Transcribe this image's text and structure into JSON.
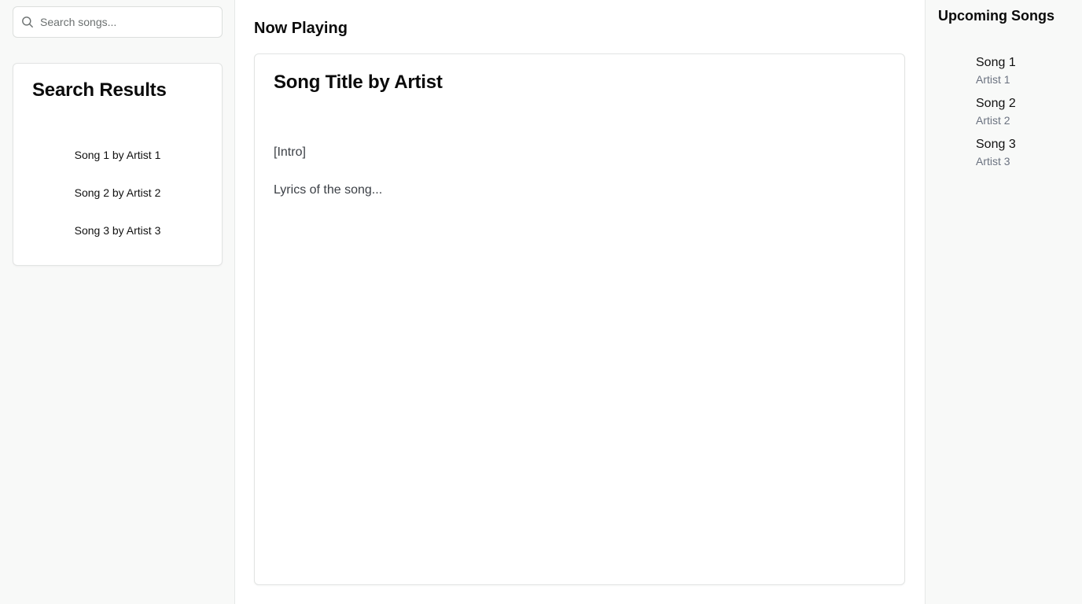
{
  "search": {
    "placeholder": "Search songs...",
    "icon": "search-icon"
  },
  "search_results": {
    "title": "Search Results",
    "items": [
      {
        "label": "Song 1 by Artist 1"
      },
      {
        "label": "Song 2 by Artist 2"
      },
      {
        "label": "Song 3 by Artist 3"
      }
    ]
  },
  "now_playing": {
    "heading": "Now Playing",
    "song_title": "Song Title by Artist",
    "lyrics": [
      "[Intro]",
      "Lyrics of the song..."
    ]
  },
  "upcoming": {
    "title": "Upcoming Songs",
    "items": [
      {
        "song": "Song 1",
        "artist": "Artist 1"
      },
      {
        "song": "Song 2",
        "artist": "Artist 2"
      },
      {
        "song": "Song 3",
        "artist": "Artist 3"
      }
    ]
  }
}
